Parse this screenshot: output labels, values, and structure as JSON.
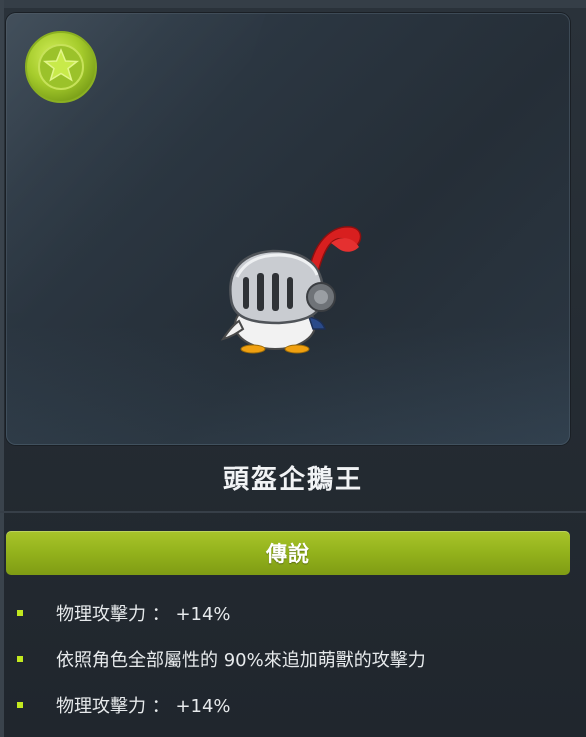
{
  "pet": {
    "name": "頭盔企鵝王",
    "grade": "傳說"
  },
  "icons": {
    "badge": "star-icon",
    "figure": "knight-helmet-penguin"
  },
  "stats": [
    {
      "text": "物理攻擊力 ： +14%"
    },
    {
      "text": "依照角色全部屬性的 90%來追加萌獸的攻擊力"
    },
    {
      "text": "物理攻擊力 ： +14%"
    }
  ],
  "colors": {
    "background": "#1f252c",
    "card": "#2b3641",
    "grade_bar": "#93b21c",
    "bullet": "#c2e81f",
    "badge": "#a6cc2c",
    "text": "#e7eaec"
  }
}
